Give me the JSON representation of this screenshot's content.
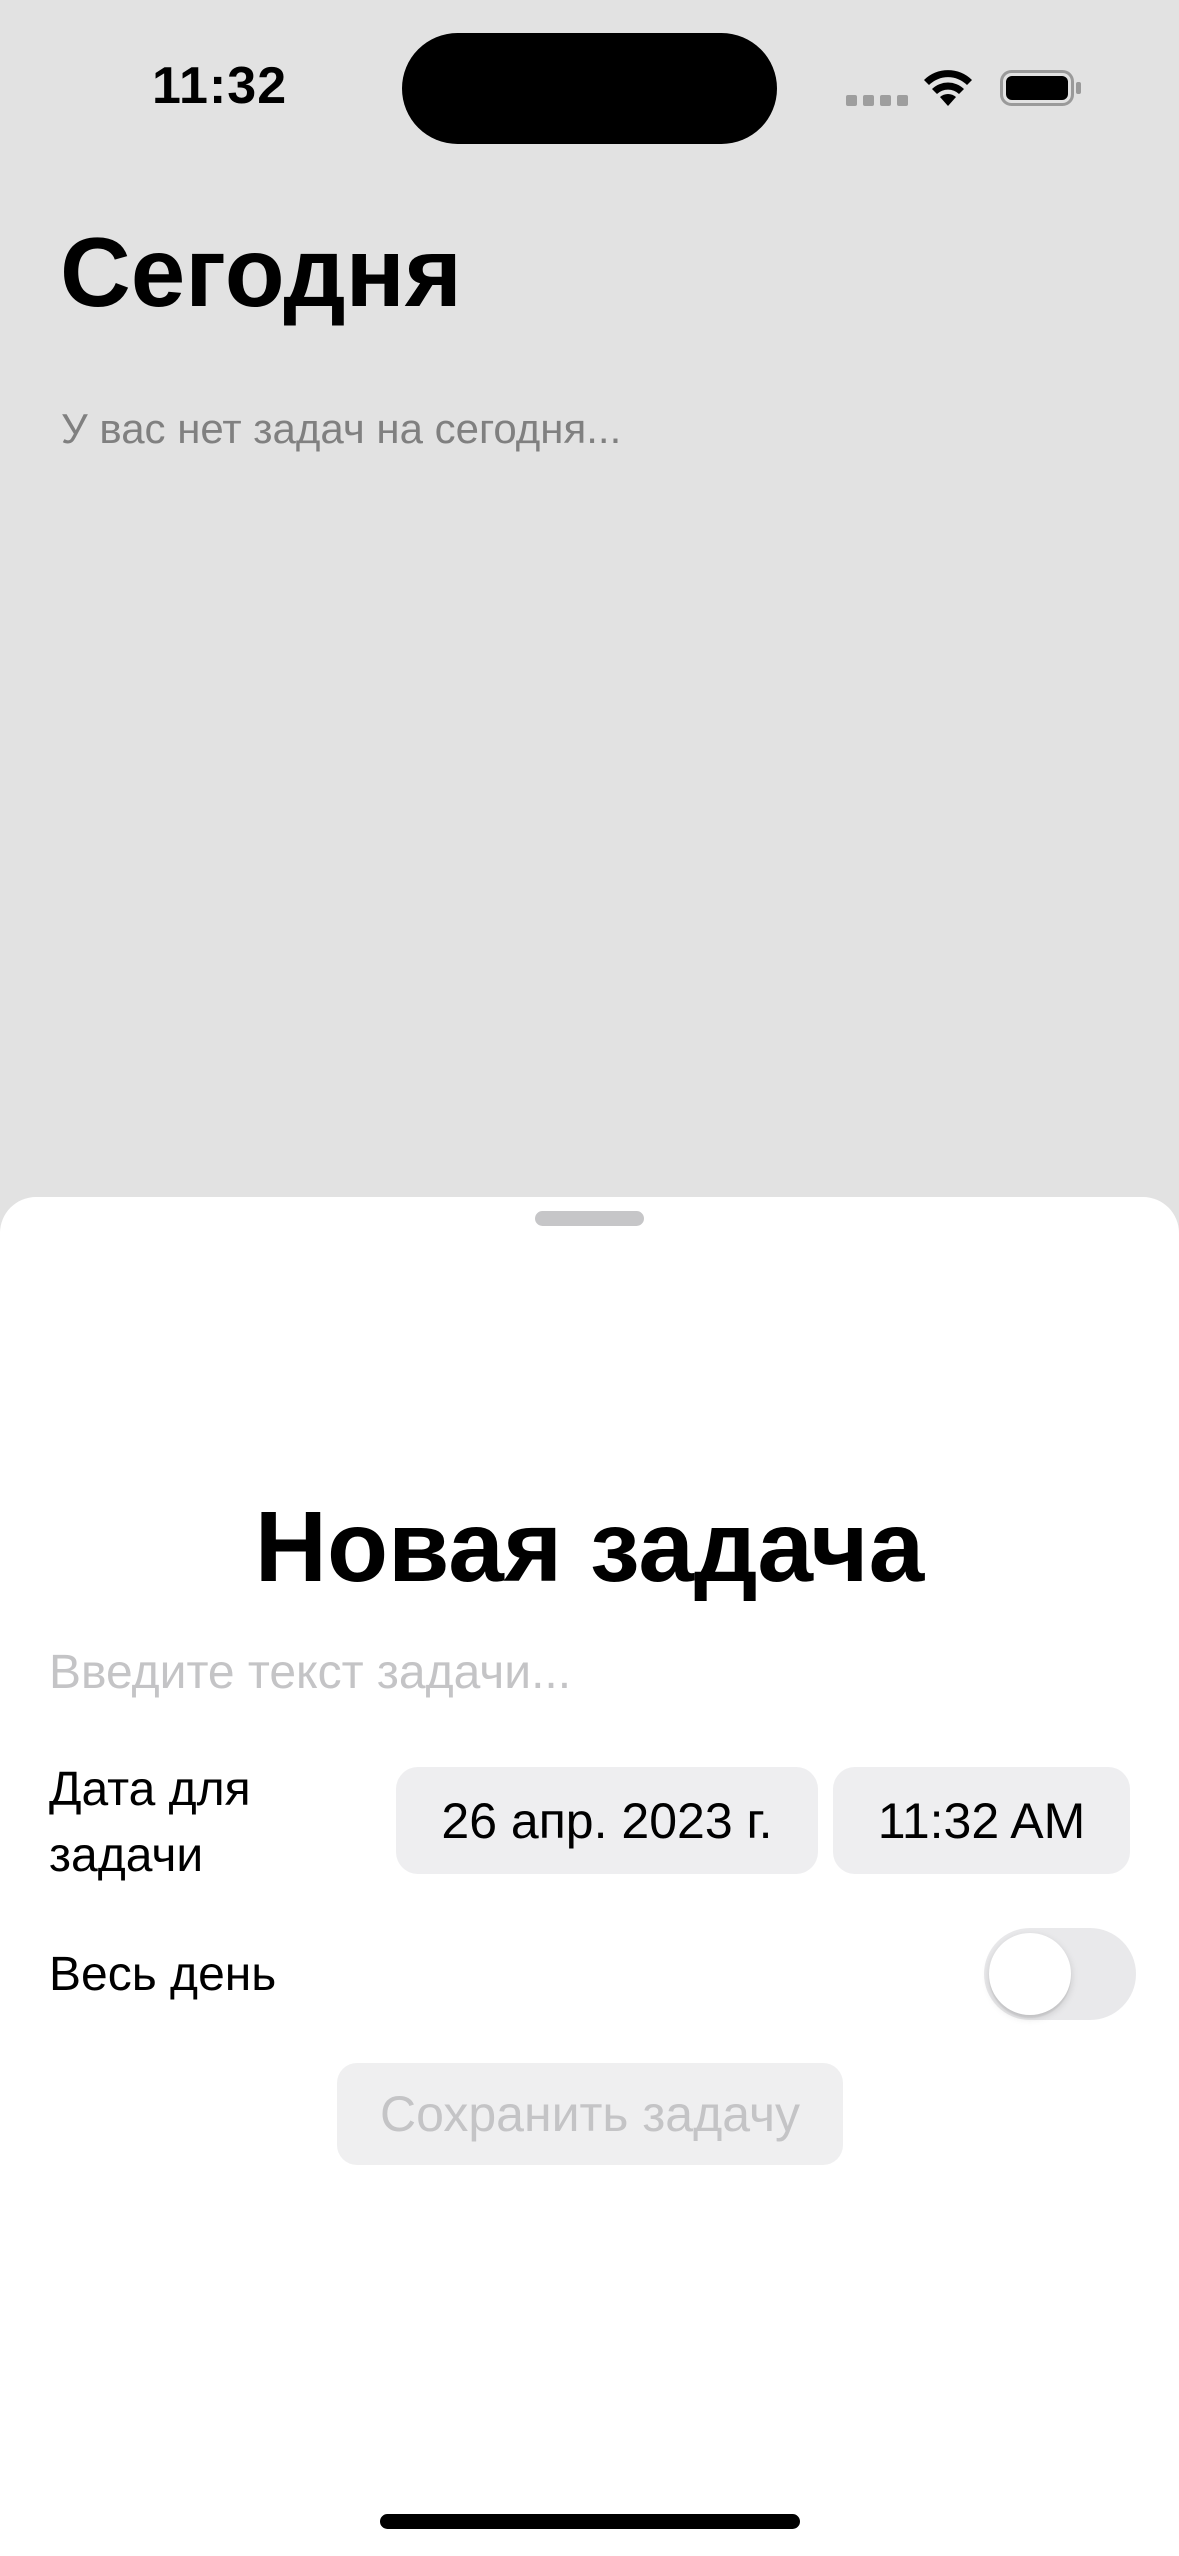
{
  "status_bar": {
    "time": "11:32",
    "icons": [
      "cellular-icon",
      "wifi-icon",
      "battery-icon"
    ]
  },
  "background_screen": {
    "title": "Сегодня",
    "empty_message": "У вас нет задач на сегодня..."
  },
  "sheet": {
    "title": "Новая задача",
    "task_input": {
      "value": "",
      "placeholder": "Введите текст задачи..."
    },
    "date_label": "Дата для задачи",
    "date_value": "26 апр. 2023 г.",
    "time_value": "11:32 AM",
    "all_day_label": "Весь день",
    "all_day_on": false,
    "save_label": "Сохранить задачу",
    "save_enabled": false
  },
  "colors": {
    "dimmed_background": "#e2e2e2",
    "sheet_background": "#ffffff",
    "pill_background": "#eeeef0",
    "placeholder": "#c4c4c6",
    "secondary_text": "#808080"
  }
}
